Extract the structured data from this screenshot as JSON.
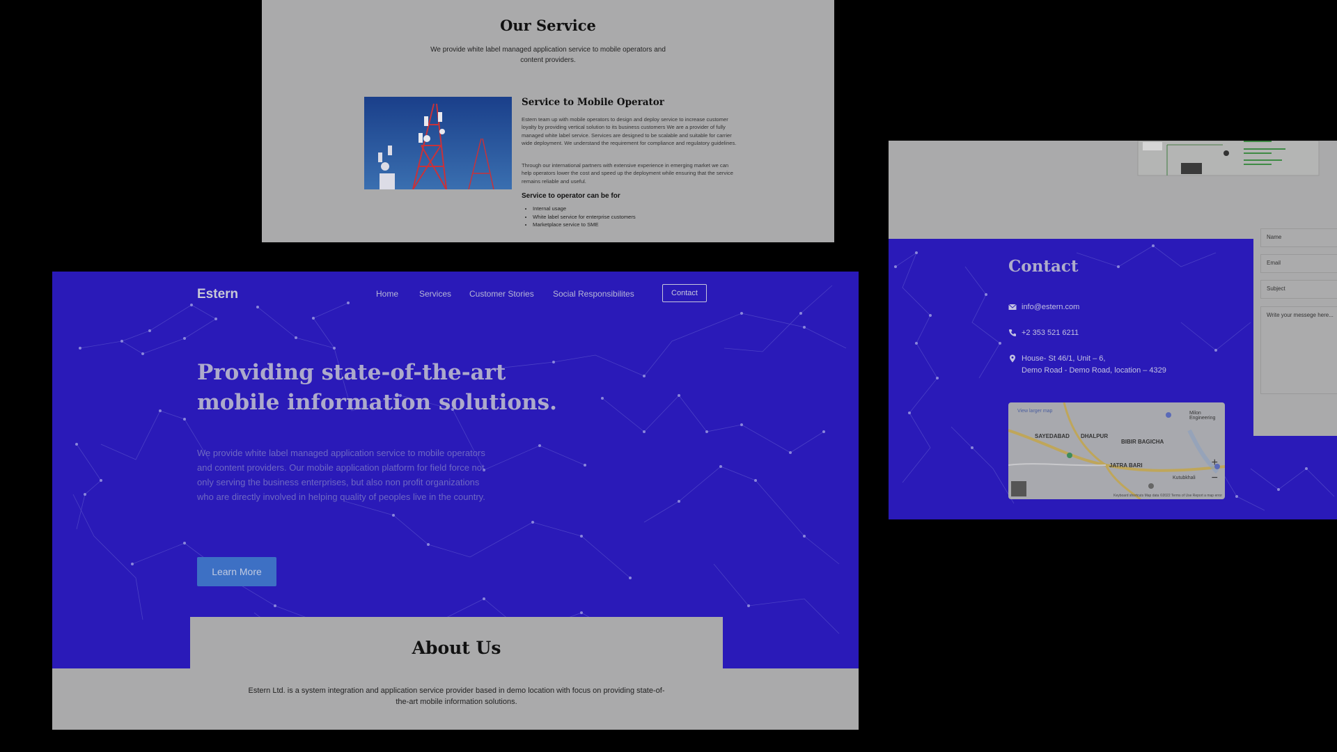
{
  "services": {
    "title": "Our Service",
    "subtitle": "We provide white label managed application service to mobile operators and content providers.",
    "heading": "Service to Mobile Operator",
    "para1": "Estern team up with mobile operators to design and deploy service to increase customer loyalty by providing vertical solution to its business customers We are a provider of fully managed white label service. Services are designed to be scalable and suitable for carrier wide deployment. We understand the requirement for compliance and regulatory guidelines.",
    "para2": "Through our international partners with extensive experience in emerging market we can help operators lower the cost and speed up the deployment while ensuring that the service remains reliable and useful.",
    "list_heading": "Service to operator can be for",
    "list": [
      "Internal usage",
      "White label service for enterprise customers",
      "Marketplace service to SME"
    ]
  },
  "hero": {
    "logo": "Estern",
    "nav": [
      "Home",
      "Services",
      "Customer Stories",
      "Social Responsibilites"
    ],
    "contact_button": "Contact",
    "headline": "Providing state-of-the-art mobile information solutions.",
    "lead": "We provide white label managed application service to mobile operators and content providers. Our mobile application platform for field force not only serving the business enterprises, but also non profit organizations who are directly involved in helping quality of peoples live in the country.",
    "cta": "Learn More"
  },
  "about": {
    "title": "About Us",
    "text": "Estern Ltd. is a system integration and application service provider based in demo location with focus on providing state-of-the-art mobile information solutions."
  },
  "contact": {
    "title": "Contact",
    "email": "info@estern.com",
    "phone": "+2 353 521 6211",
    "address_line1": "House- St 46/1, Unit – 6,",
    "address_line2": "Demo Road - Demo Road, location – 4329",
    "map": {
      "link": "View larger map",
      "labels": [
        "SAYEDABAD",
        "DHALPUR",
        "BIBIR BAGICHA",
        "JATRA BARI",
        "Milon Engineering",
        "Kutubkhali"
      ],
      "footer": "Keyboard shortcuts   Map data ©2022   Terms of Use   Report a map error"
    },
    "form": {
      "name_placeholder": "Name",
      "email_placeholder": "Email",
      "subject_placeholder": "Subject",
      "message_placeholder": "Write your messege here..."
    }
  },
  "colors": {
    "hero_blue": "#2a1ab8",
    "dim_gray": "#aaaaab",
    "button_blue": "#3d70c4"
  }
}
